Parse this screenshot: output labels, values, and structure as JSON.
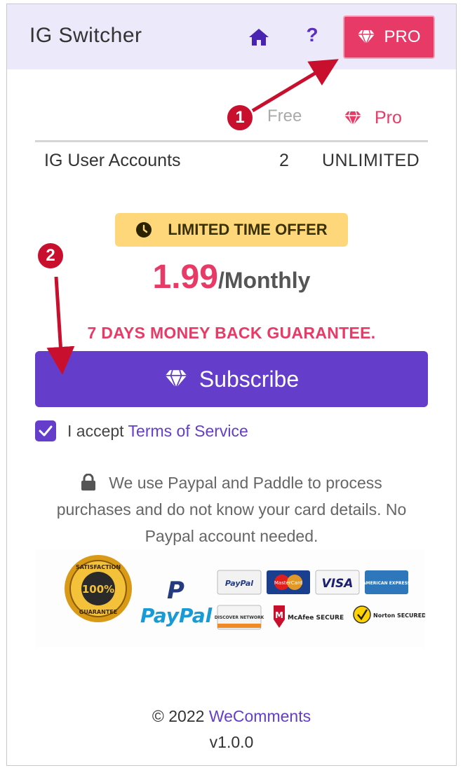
{
  "header": {
    "title": "IG Switcher",
    "help_label": "?",
    "pro_label": "PRO"
  },
  "comparison": {
    "col_free": "Free",
    "col_pro": "Pro",
    "rows": [
      {
        "feature": "IG User Accounts",
        "free": "2",
        "pro": "UNLIMITED"
      }
    ]
  },
  "offer": {
    "badge_label": "LIMITED TIME OFFER",
    "price": "1.99",
    "period": "/Monthly",
    "guarantee": "7 DAYS MONEY BACK GUARANTEE."
  },
  "subscribe": {
    "label": "Subscribe"
  },
  "terms": {
    "checked": true,
    "prefix": "I accept",
    "link": "Terms of Service"
  },
  "security_note": "We use Paypal and Paddle to process purchases and do not know your card details. No Paypal account needed.",
  "payment_badges": {
    "seal_top": "SATISFACTION",
    "seal_center": "100%",
    "seal_bottom": "GUARANTEE",
    "paypal_logo": "PayPal",
    "cards": [
      "PayPal",
      "MasterCard",
      "VISA",
      "AMERICAN EXPRESS",
      "DISCOVER NETWORK",
      "McAfee SECURE",
      "Norton SECURED"
    ]
  },
  "footer": {
    "copyright": "© 2022",
    "brand": "WeComments",
    "version": "v1.0.0"
  },
  "annotations": {
    "callout_1": "1",
    "callout_2": "2"
  },
  "colors": {
    "accent": "#643ecb",
    "pro": "#e83a66",
    "header_bg": "#ece9fa",
    "offer_bg": "#fdd77a",
    "annotation": "#c8102e"
  }
}
